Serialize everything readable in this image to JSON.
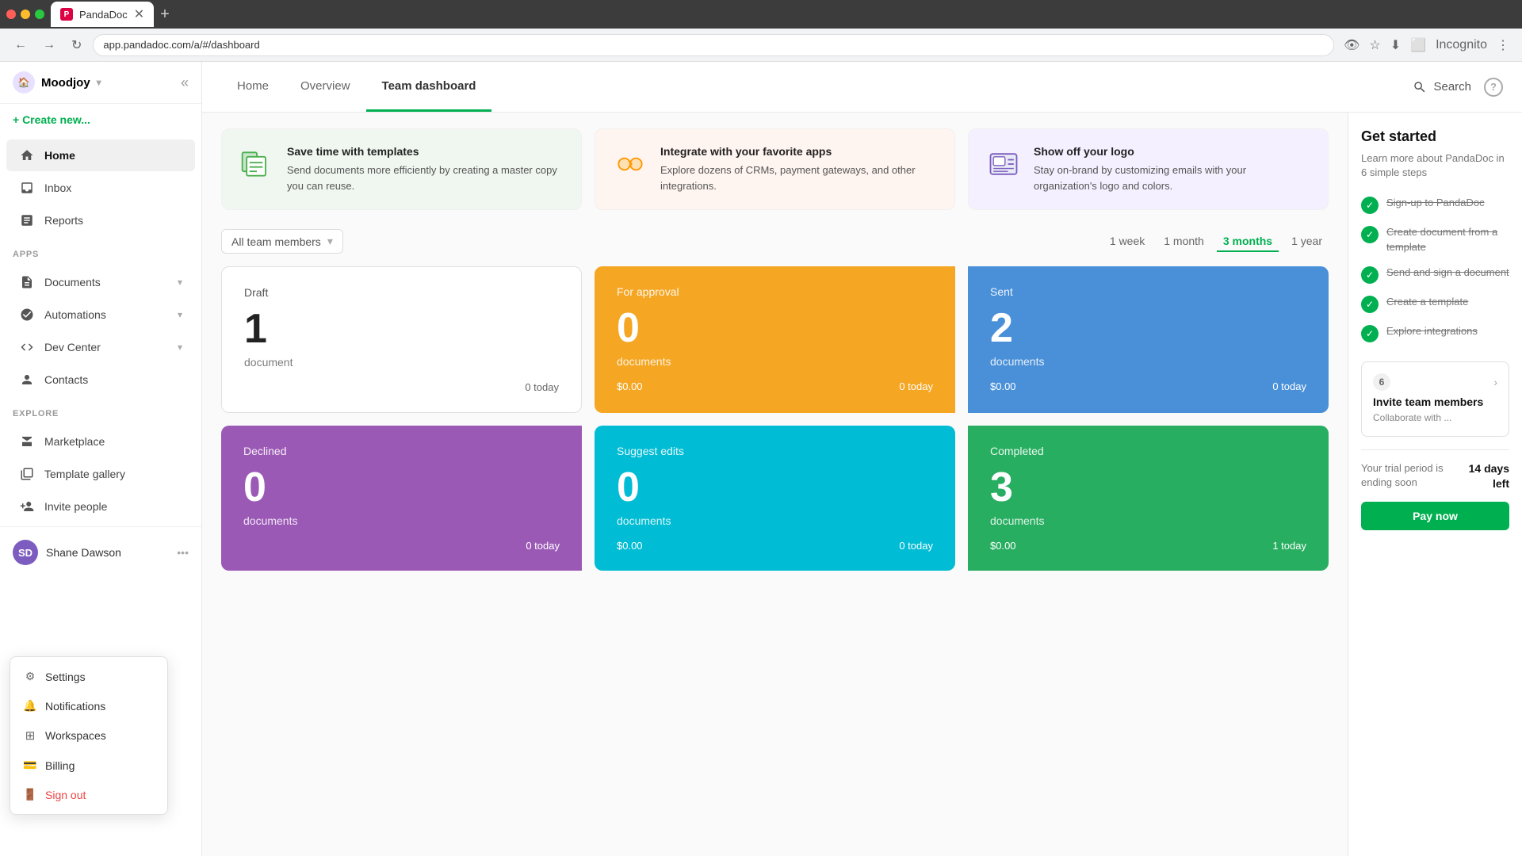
{
  "browser": {
    "url": "app.pandadoc.com/a/#/dashboard",
    "tab_title": "PandaDoc",
    "tab_icon": "P"
  },
  "sidebar": {
    "brand": "Moodjoy",
    "create_new": "+ Create new...",
    "nav_items": [
      {
        "id": "home",
        "label": "Home",
        "icon": "home",
        "active": true
      },
      {
        "id": "inbox",
        "label": "Inbox",
        "icon": "inbox"
      },
      {
        "id": "reports",
        "label": "Reports",
        "icon": "reports"
      }
    ],
    "apps_section": "APPS",
    "apps_items": [
      {
        "id": "documents",
        "label": "Documents",
        "icon": "docs",
        "has_chevron": true
      },
      {
        "id": "automations",
        "label": "Automations",
        "icon": "auto",
        "has_chevron": true
      },
      {
        "id": "dev-center",
        "label": "Dev Center",
        "icon": "dev",
        "has_chevron": true
      },
      {
        "id": "contacts",
        "label": "Contacts",
        "icon": "contacts"
      }
    ],
    "explore_section": "EXPLORE",
    "explore_items": [
      {
        "id": "marketplace",
        "label": "Marketplace",
        "icon": "market"
      },
      {
        "id": "template-gallery",
        "label": "Template gallery",
        "icon": "gallery"
      },
      {
        "id": "invite-people",
        "label": "Invite people",
        "icon": "invite"
      }
    ],
    "user": {
      "name": "Shane Dawson",
      "initials": "SD"
    }
  },
  "context_menu": {
    "items": [
      {
        "id": "settings",
        "label": "Settings",
        "icon": "⚙"
      },
      {
        "id": "notifications",
        "label": "Notifications",
        "icon": "🔔"
      },
      {
        "id": "workspaces",
        "label": "Workspaces",
        "icon": "⊞"
      },
      {
        "id": "billing",
        "label": "Billing",
        "icon": "💳"
      },
      {
        "id": "signout",
        "label": "Sign out",
        "icon": "→",
        "is_signout": true
      }
    ]
  },
  "header": {
    "tabs": [
      "Home",
      "Overview",
      "Team dashboard"
    ],
    "active_tab": "Team dashboard",
    "search_label": "Search",
    "help_label": "?"
  },
  "feature_cards": [
    {
      "id": "templates",
      "bg": "green",
      "title": "Save time with templates",
      "desc": "Send documents more efficiently by creating a master copy you can reuse."
    },
    {
      "id": "integrate",
      "bg": "peach",
      "title": "Integrate with your favorite apps",
      "desc": "Explore dozens of CRMs, payment gateways, and other integrations."
    },
    {
      "id": "logo",
      "bg": "lavender",
      "title": "Show off your logo",
      "desc": "Stay on-brand by customizing emails with your organization's logo and colors."
    }
  ],
  "filters": {
    "team_filter": "All team members",
    "time_options": [
      "1 week",
      "1 month",
      "3 months",
      "1 year"
    ],
    "active_time": "3 months"
  },
  "stats": [
    {
      "id": "draft",
      "label": "Draft",
      "number": "1",
      "docs": "document",
      "amount": "",
      "today": "0 today",
      "style": "draft"
    },
    {
      "id": "for-approval",
      "label": "For approval",
      "number": "0",
      "docs": "documents",
      "amount": "$0.00",
      "today": "0 today",
      "style": "for-approval"
    },
    {
      "id": "sent",
      "label": "Sent",
      "number": "2",
      "docs": "documents",
      "amount": "$0.00",
      "today": "0 today",
      "style": "sent"
    },
    {
      "id": "declined",
      "label": "Declined",
      "number": "0",
      "docs": "documents",
      "amount": "",
      "today": "0 today",
      "style": "declined"
    },
    {
      "id": "suggest-edits",
      "label": "Suggest edits",
      "number": "0",
      "docs": "documents",
      "amount": "$0.00",
      "today": "0 today",
      "style": "suggest-edits"
    },
    {
      "id": "completed",
      "label": "Completed",
      "number": "3",
      "docs": "documents",
      "amount": "$0.00",
      "today": "1 today",
      "style": "completed"
    }
  ],
  "right_panel": {
    "title": "Get started",
    "subtitle": "Learn more about PandaDoc in 6 simple steps",
    "steps": [
      {
        "id": "signup",
        "label": "Sign-up to PandaDoc",
        "done": true
      },
      {
        "id": "create-doc",
        "label": "Create document from a template",
        "done": true
      },
      {
        "id": "send-sign",
        "label": "Send and sign a document",
        "done": true
      },
      {
        "id": "create-template",
        "label": "Create a template",
        "done": true
      },
      {
        "id": "explore-integrations",
        "label": "Explore integrations",
        "done": true
      }
    ],
    "invite": {
      "step_number": "6",
      "title": "Invite team members",
      "desc": "Collaborate with ..."
    },
    "trial": {
      "text": "Your trial period is ending soon",
      "days": "14 days left"
    },
    "pay_now": "Pay now"
  }
}
